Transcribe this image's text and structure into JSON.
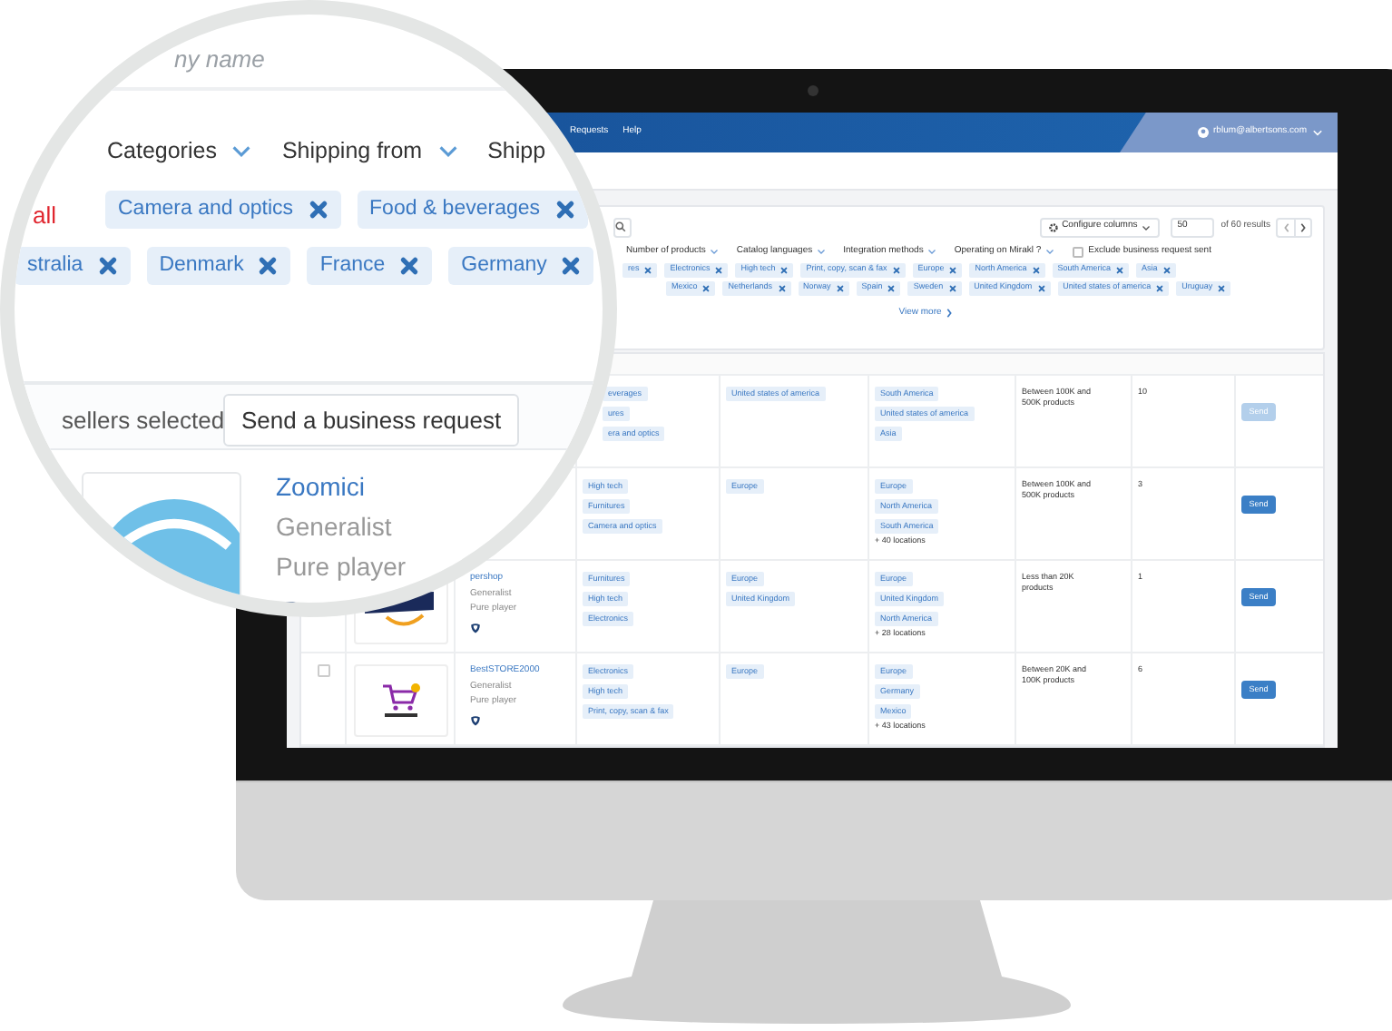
{
  "screen": {
    "nav": {
      "items": [
        "Requests",
        "Help"
      ],
      "account": "rblum@albertsons.com"
    },
    "toolbar": {
      "configure_button": "Configure columns",
      "page_size": "50",
      "results": "of 60 results"
    },
    "filters": [
      "Number of products",
      "Catalog languages",
      "Integration methods",
      "Operating on Mirakl ?"
    ],
    "exclude_checkbox": {
      "label": "Exclude business request sent",
      "checked": false
    },
    "tag_rows": [
      [
        "res",
        "Electronics",
        "High tech",
        "Print, copy, scan & fax",
        "Europe",
        "North America",
        "South America",
        "Asia"
      ],
      [
        "Mexico",
        "Netherlands",
        "Norway",
        "Spain",
        "Sweden",
        "United Kingdom",
        "United states of america",
        "Uruguay"
      ]
    ],
    "view_more": "View more",
    "rows": [
      {
        "categories": [
          "everages",
          "ures",
          "era and optics"
        ],
        "shipping_from": [
          "United states of america"
        ],
        "shipping_to": [
          "South America",
          "United states of america",
          "Asia"
        ],
        "products": "Between 100K and 500K products",
        "count": "10",
        "send": {
          "label": "Send",
          "disabled": true
        }
      },
      {
        "categories": [
          "High tech",
          "Furnitures",
          "Camera and optics"
        ],
        "shipping_from": [
          "Europe"
        ],
        "shipping_to": [
          "Europe",
          "North America",
          "South America"
        ],
        "more_locations": "+ 40 locations",
        "products": "Between 100K and 500K products",
        "count": "3",
        "send": {
          "label": "Send",
          "disabled": false
        }
      },
      {
        "seller": {
          "name": "pershop",
          "type": "Generalist",
          "model": "Pure player"
        },
        "categories": [
          "Furnitures",
          "High tech",
          "Electronics"
        ],
        "shipping_from": [
          "Europe",
          "United Kingdom"
        ],
        "shipping_to": [
          "Europe",
          "United Kingdom",
          "North America"
        ],
        "more_locations": "+ 28 locations",
        "products": "Less than 20K products",
        "count": "1",
        "send": {
          "label": "Send",
          "disabled": false
        }
      },
      {
        "checkbox": {
          "checked": false
        },
        "seller": {
          "name": "BestSTORE2000",
          "type": "Generalist",
          "model": "Pure player"
        },
        "categories": [
          "Electronics",
          "High tech",
          "Print, copy, scan & fax"
        ],
        "shipping_from": [
          "Europe"
        ],
        "shipping_to": [
          "Europe",
          "Germany",
          "Mexico"
        ],
        "more_locations": "+ 43 locations",
        "products": "Between 20K and 100K products",
        "count": "6",
        "send": {
          "label": "Send",
          "disabled": false
        }
      }
    ]
  },
  "magnifier": {
    "search": {
      "placeholder": "ny name"
    },
    "filters": [
      "Categories",
      "Shipping from",
      "Shipp"
    ],
    "clear_link": "all",
    "tag_rows": [
      [
        "Camera and optics",
        "Food & beverages"
      ],
      [
        "stralia",
        "Denmark",
        "France",
        "Germany"
      ]
    ],
    "selection": "sellers selected",
    "send_request_button": "Send a business request",
    "seller": {
      "name": "Zoomici",
      "type": "Generalist",
      "model": "Pure player"
    }
  }
}
